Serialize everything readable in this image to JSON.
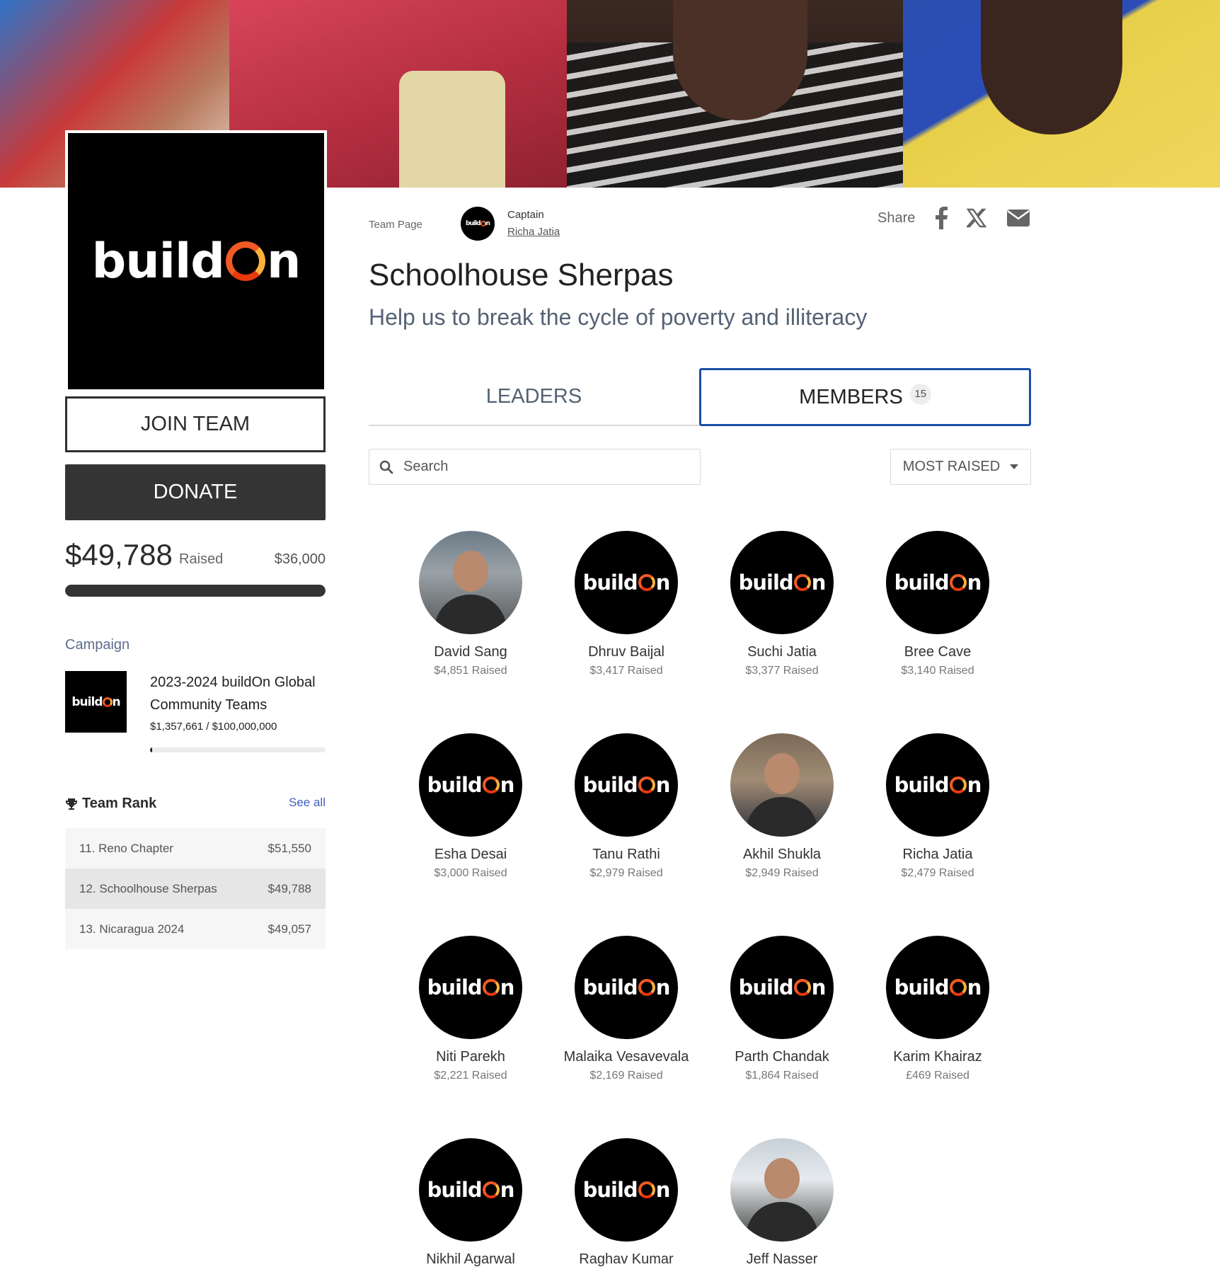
{
  "banner": {
    "alt": ""
  },
  "team": {
    "logo_text": "buildOn",
    "join_label": "JOIN TEAM",
    "donate_label": "DONATE",
    "raised_amount": "$49,788",
    "raised_label": "Raised",
    "goal": "$36,000",
    "progress_fraction": 1.0
  },
  "header": {
    "page_type": "Team Page",
    "captain_label": "Captain",
    "captain_name": "Richa Jatia",
    "share_label": "Share",
    "share_icons": [
      "facebook-icon",
      "x-icon",
      "email-icon"
    ],
    "title": "Schoolhouse Sherpas",
    "subtitle": "Help us to break the cycle of poverty and illiteracy"
  },
  "campaign": {
    "heading": "Campaign",
    "name": "2023-2024 buildOn Global Community Teams",
    "amount": "$1,357,661 / $100,000,000",
    "progress_fraction": 0.0136
  },
  "team_rank": {
    "heading": "Team Rank",
    "see_all": "See all",
    "rows": [
      {
        "label": "11. Reno Chapter",
        "amount": "$51,550",
        "current": false
      },
      {
        "label": "12. Schoolhouse Sherpas",
        "amount": "$49,788",
        "current": true
      },
      {
        "label": "13. Nicaragua 2024",
        "amount": "$49,057",
        "current": false
      }
    ]
  },
  "tabs": {
    "leaders": "LEADERS",
    "members": "MEMBERS",
    "members_count": "15",
    "active": "members"
  },
  "search": {
    "placeholder": "Search"
  },
  "sort": {
    "label": "MOST RAISED"
  },
  "members": [
    {
      "name": "David Sang",
      "raised": "$4,851 Raised",
      "photo": true
    },
    {
      "name": "Dhruv Baijal",
      "raised": "$3,417 Raised",
      "photo": false
    },
    {
      "name": "Suchi Jatia",
      "raised": "$3,377 Raised",
      "photo": false
    },
    {
      "name": "Bree Cave",
      "raised": "$3,140 Raised",
      "photo": false
    },
    {
      "name": "Esha Desai",
      "raised": "$3,000 Raised",
      "photo": false
    },
    {
      "name": "Tanu Rathi",
      "raised": "$2,979 Raised",
      "photo": false
    },
    {
      "name": "Akhil Shukla",
      "raised": "$2,949 Raised",
      "photo": true
    },
    {
      "name": "Richa Jatia",
      "raised": "$2,479 Raised",
      "photo": false
    },
    {
      "name": "Niti Parekh",
      "raised": "$2,221 Raised",
      "photo": false
    },
    {
      "name": "Malaika Vesavevala",
      "raised": "$2,169 Raised",
      "photo": false
    },
    {
      "name": "Parth Chandak",
      "raised": "$1,864 Raised",
      "photo": false
    },
    {
      "name": "Karim Khairaz",
      "raised": "£469 Raised",
      "photo": false
    },
    {
      "name": "Nikhil Agarwal",
      "raised": "",
      "photo": false
    },
    {
      "name": "Raghav Kumar",
      "raised": "",
      "photo": false
    },
    {
      "name": "Jeff Nasser",
      "raised": "",
      "photo": true
    }
  ],
  "colors": {
    "accent_blue": "#1d4fa8",
    "dark_button": "#343434",
    "link": "#3f5fbf",
    "logo_orange": "#f15a24"
  }
}
